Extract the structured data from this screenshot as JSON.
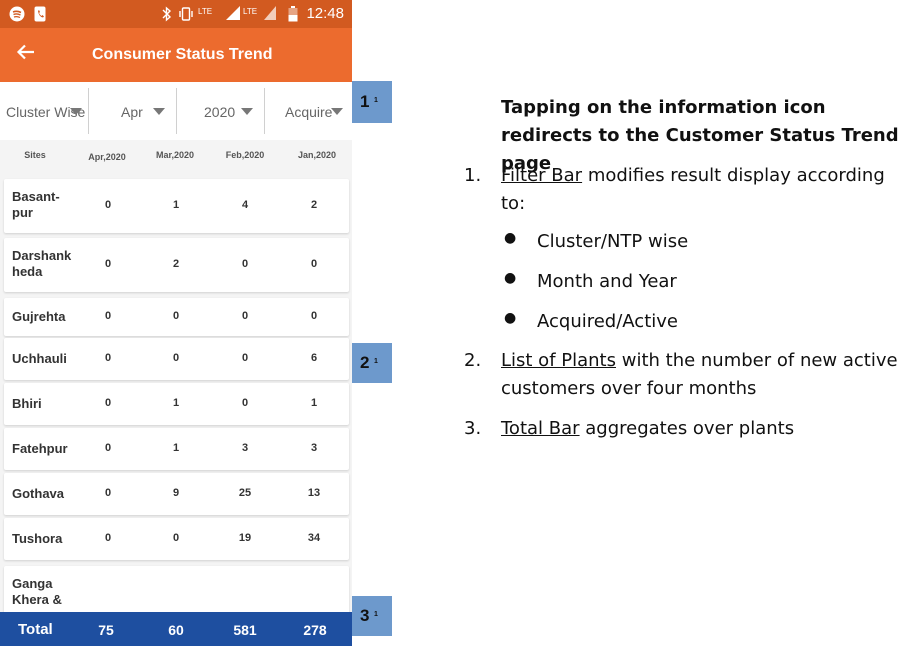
{
  "status_bar": {
    "time": "12:48",
    "icons": [
      "spotify-icon",
      "phone-icon",
      "bluetooth-icon",
      "vibrate-icon",
      "lte-call-icon",
      "signal-icon",
      "lte-icon",
      "battery-icon"
    ],
    "lte1": "LTE",
    "lte2": "LTE"
  },
  "app_bar": {
    "title": "Consumer Status Trend",
    "back_icon": "back-arrow-icon"
  },
  "filters": [
    {
      "value": "Cluster Wise"
    },
    {
      "value": "Apr"
    },
    {
      "value": "2020"
    },
    {
      "value": "Acquire"
    }
  ],
  "table": {
    "headers": [
      "Sites",
      "Apr,2020",
      "Mar,2020",
      "Feb,2020",
      "Jan,2020"
    ],
    "rows": [
      {
        "site": "Basant-\npur",
        "values": [
          "0",
          "1",
          "4",
          "2"
        ]
      },
      {
        "site": "Darshank\nheda",
        "values": [
          "0",
          "2",
          "0",
          "0"
        ]
      },
      {
        "site": "Gujrehta",
        "values": [
          "0",
          "0",
          "0",
          "0"
        ]
      },
      {
        "site": "Uchhauli",
        "values": [
          "0",
          "0",
          "0",
          "6"
        ]
      },
      {
        "site": "Bhiri",
        "values": [
          "0",
          "1",
          "0",
          "1"
        ]
      },
      {
        "site": "Fatehpur",
        "values": [
          "0",
          "1",
          "3",
          "3"
        ]
      },
      {
        "site": "Gothava",
        "values": [
          "0",
          "9",
          "25",
          "13"
        ]
      },
      {
        "site": "Tushora",
        "values": [
          "0",
          "0",
          "19",
          "34"
        ]
      },
      {
        "site": "Ganga\nKhera &",
        "values": [
          "",
          "",
          "",
          ""
        ]
      }
    ]
  },
  "total": {
    "label": "Total",
    "values": [
      "75",
      "60",
      "581",
      "278"
    ]
  },
  "markers": [
    {
      "num": "1",
      "sup": "1"
    },
    {
      "num": "2",
      "sup": "1"
    },
    {
      "num": "3",
      "sup": "1"
    }
  ],
  "explanation": {
    "heading": "Tapping on the information icon redirects to the Customer Status Trend page",
    "item1_num": "1.",
    "item1_link": "Filter Bar",
    "item1_rest": " modifies result display according to:",
    "bullets": [
      "Cluster/NTP wise",
      "Month and Year",
      "Acquired/Active"
    ],
    "item2_num": "2.",
    "item2_link": "List of Plants",
    "item2_rest": " with the number of new active customers over four months",
    "item3_num": "3.",
    "item3_link": "Total Bar",
    "item3_rest": " aggregates over plants"
  },
  "colors": {
    "status_bar": "#d25a20",
    "app_bar": "#ec6b2e",
    "total_bar": "#1e4fa0",
    "marker": "#6d99cc"
  }
}
